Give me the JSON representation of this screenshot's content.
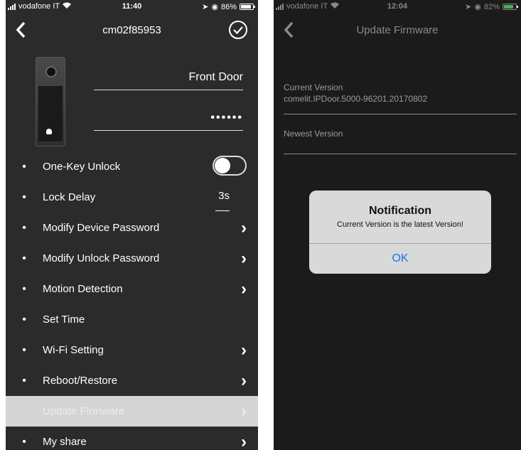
{
  "left_screen": {
    "status": {
      "carrier": "vodafone IT",
      "time": "11:40",
      "battery": "86%",
      "battery_level": 0.86
    },
    "nav": {
      "title": "cm02f85953",
      "back_icon": "chevron-left-icon",
      "confirm_icon": "check-circle-icon"
    },
    "device": {
      "name": "Front Door",
      "password": "••••••"
    },
    "rows": [
      {
        "label": "One-Key Unlock",
        "toggle_on": false
      },
      {
        "label": "Lock Delay",
        "value": "3s"
      },
      {
        "label": "Modify Device Password"
      },
      {
        "label": "Modify Unlock Password"
      },
      {
        "label": "Motion Detection"
      },
      {
        "label": "Set Time"
      },
      {
        "label": "Wi-Fi Setting"
      },
      {
        "label": "Reboot/Restore"
      },
      {
        "label": "Update Firmware"
      },
      {
        "label": "My share"
      }
    ]
  },
  "right_screen": {
    "status": {
      "carrier": "vodafone IT",
      "time": "12:04",
      "battery": "82%",
      "battery_level": 0.82
    },
    "nav": {
      "title": "Update Firmware"
    },
    "current_version_label": "Current Version",
    "current_version_value": "comelit.IPDoor.5000-96201.20170802",
    "newest_version_label": "Newest Version",
    "dialog": {
      "title": "Notification",
      "message": "Current Version is the latest Version!",
      "ok_label": "OK"
    }
  },
  "colors": {
    "accent": "#1a73e8",
    "selected_row": "#d4d4d4"
  }
}
